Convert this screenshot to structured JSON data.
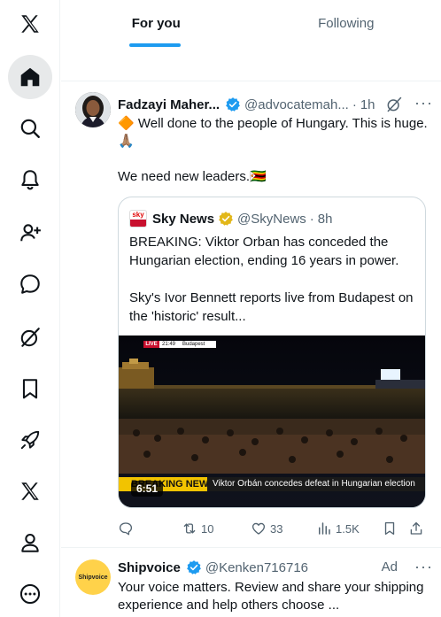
{
  "tabs": [
    {
      "label": "For you",
      "active": true
    },
    {
      "label": "Following",
      "active": false
    }
  ],
  "nav": [
    {
      "icon": "x-logo-icon",
      "active": false
    },
    {
      "icon": "home-icon",
      "active": true
    },
    {
      "icon": "search-icon",
      "active": false
    },
    {
      "icon": "bell-icon",
      "active": false
    },
    {
      "icon": "follow-icon",
      "active": false
    },
    {
      "icon": "chat-icon",
      "active": false
    },
    {
      "icon": "grok-icon",
      "active": false
    },
    {
      "icon": "bookmark-icon",
      "active": false
    },
    {
      "icon": "rocket-icon",
      "active": false
    },
    {
      "icon": "x-premium-icon",
      "active": false
    },
    {
      "icon": "profile-icon",
      "active": false
    },
    {
      "icon": "more-circle-icon",
      "active": false
    }
  ],
  "post": {
    "author": "Fadzayi Maher...",
    "handle": "@advocatemah...",
    "dot": "·",
    "time": "1h",
    "more": "···",
    "line1": "🔶 Well done to the people of Hungary. This is huge.🙏🏽",
    "line2": "We need new leaders.🇿🇼",
    "quote": {
      "logo_text": "sky",
      "author": "Sky News",
      "handle": "@SkyNews",
      "dot": "·",
      "time": "8h",
      "para1": "BREAKING: Viktor Orban has conceded the Hungarian election, ending 16 years in power.",
      "para2": "Sky's Ivor Bennett reports live from Budapest on the 'historic' result...",
      "video": {
        "live_tag": "LIVE",
        "clock": "21:49",
        "place": "Budapest",
        "breaking": "BREAKING NEWS",
        "ticker": "Viktor Orbán concedes defeat in Hungarian election",
        "duration": "6:51"
      }
    },
    "actions": {
      "reply": "",
      "repost": "10",
      "like": "33",
      "views": "1.5K"
    }
  },
  "ad": {
    "avatar_text": "Shipvoice",
    "author": "Shipvoice",
    "handle": "@Kenken716716",
    "label": "Ad",
    "more": "···",
    "text": "Your voice matters. Review and share your shipping experience and help others choose ..."
  },
  "colors": {
    "accent": "#1d9bf0",
    "muted": "#536471",
    "border": "#cfd9de",
    "verified_blue": "#1d9bf0",
    "verified_gold": "#e2b719"
  }
}
